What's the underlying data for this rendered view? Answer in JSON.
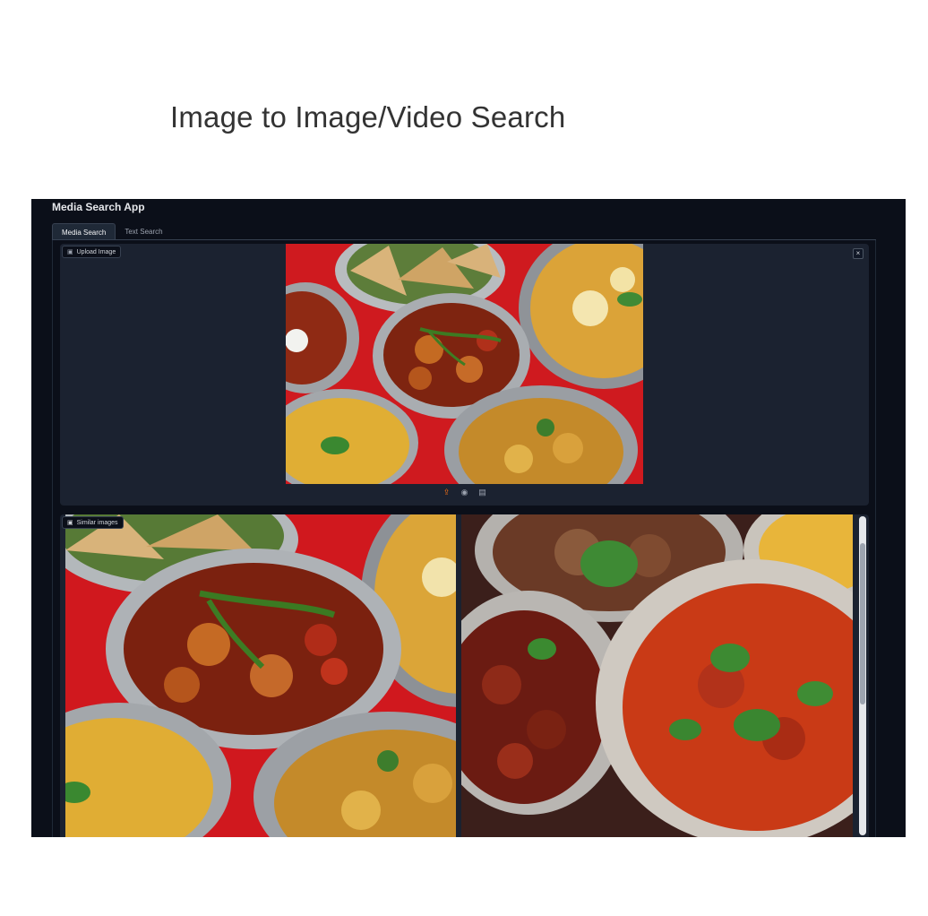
{
  "slide": {
    "title": "Image to Image/Video Search"
  },
  "app": {
    "title": "Media Search App",
    "tabs": [
      {
        "label": "Media Search",
        "active": true
      },
      {
        "label": "Text Search",
        "active": false
      }
    ],
    "upload": {
      "label": "Upload Image",
      "label_icon": "image-icon",
      "close_icon": "close-icon",
      "close_glyph": "×",
      "toolbar_icons": [
        "upload-icon",
        "webcam-icon",
        "clipboard-icon"
      ]
    },
    "gallery": {
      "label": "Similar images",
      "label_icon": "image-icon"
    }
  },
  "colors": {
    "app_bg": "#0b0f19",
    "panel_bg": "#1b2230",
    "accent": "#f97316",
    "food_red": "#d2161c"
  }
}
